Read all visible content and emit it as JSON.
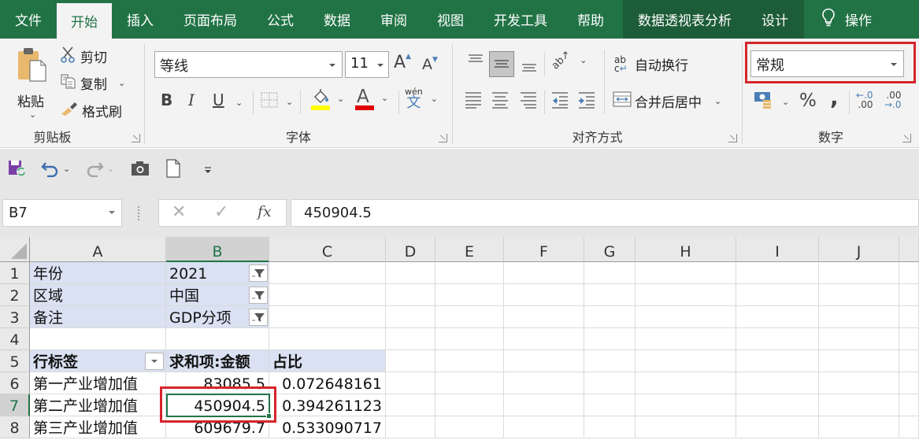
{
  "ribbon_tabs": [
    {
      "label": "文件",
      "state": "normal"
    },
    {
      "label": "开始",
      "state": "active"
    },
    {
      "label": "插入",
      "state": "normal"
    },
    {
      "label": "页面布局",
      "state": "normal"
    },
    {
      "label": "公式",
      "state": "normal"
    },
    {
      "label": "数据",
      "state": "normal"
    },
    {
      "label": "审阅",
      "state": "normal"
    },
    {
      "label": "视图",
      "state": "normal"
    },
    {
      "label": "开发工具",
      "state": "normal"
    },
    {
      "label": "帮助",
      "state": "normal"
    },
    {
      "label": "数据透视表分析",
      "state": "contextual"
    },
    {
      "label": "设计",
      "state": "contextual"
    }
  ],
  "tell_me": {
    "label": "操作",
    "icon": "lightbulb-icon"
  },
  "clipboard": {
    "group_label": "剪贴板",
    "paste": "粘贴",
    "cut": "剪切",
    "copy": "复制",
    "format_painter": "格式刷"
  },
  "font": {
    "group_label": "字体",
    "font_name": "等线",
    "font_size": "11",
    "bold": "B",
    "italic": "I",
    "underline": "U",
    "grow": "A",
    "shrink": "A",
    "font_color_letter": "A",
    "phonetic_top": "wén",
    "phonetic_bottom": "文",
    "fill_color": "#ffff00",
    "font_color": "#e00000"
  },
  "alignment": {
    "group_label": "对齐方式",
    "wrap_text": "自动换行",
    "merge_center": "合并后居中"
  },
  "number": {
    "group_label": "数字",
    "format": "常规",
    "percent": "%",
    "comma": ",",
    "inc_decimal_top": "←.0",
    "inc_decimal_bottom": ".00",
    "dec_decimal_top": ".00",
    "dec_decimal_bottom": "→.0"
  },
  "formula_bar": {
    "name_box": "B7",
    "fx": "fx",
    "formula": "450904.5"
  },
  "columns": [
    "A",
    "B",
    "C",
    "D",
    "E",
    "F",
    "G",
    "H",
    "I",
    "J"
  ],
  "selected_column": "B",
  "rows": [
    "1",
    "2",
    "3",
    "4",
    "5",
    "6",
    "7",
    "8"
  ],
  "selected_row": "7",
  "filters": [
    {
      "label": "年份",
      "value": "2021"
    },
    {
      "label": "区域",
      "value": "中国"
    },
    {
      "label": "备注",
      "value": "GDP分项"
    }
  ],
  "pivot": {
    "headers": [
      "行标签",
      "求和项:金额",
      "占比"
    ],
    "rows": [
      {
        "label": "第一产业增加值",
        "sum": "83085.5",
        "ratio": "0.072648161"
      },
      {
        "label": "第二产业增加值",
        "sum": "450904.5",
        "ratio": "0.394261123"
      },
      {
        "label": "第三产业增加值",
        "sum": "609679.7",
        "ratio": "0.533090717"
      }
    ]
  },
  "colors": {
    "brand": "#217346",
    "highlight_box": "#d6242a",
    "pivot_fill": "#d9e1f2"
  }
}
